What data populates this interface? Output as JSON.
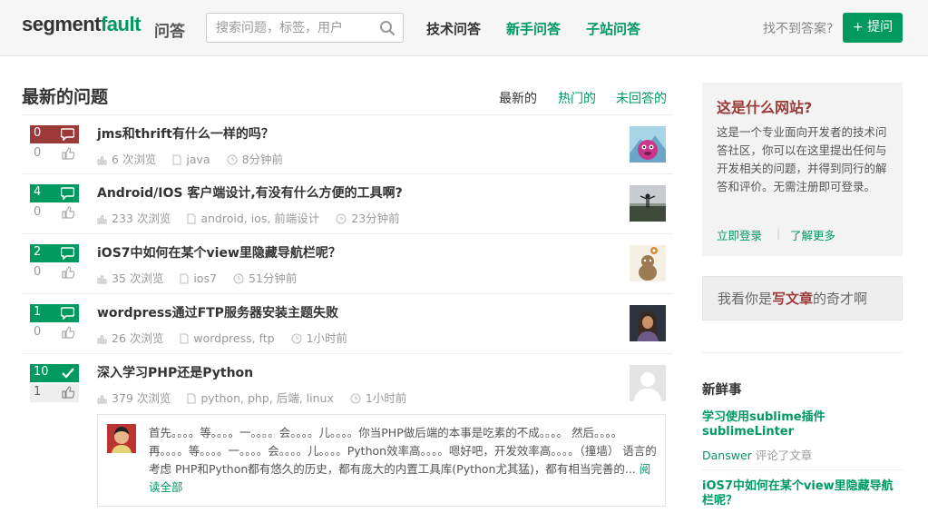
{
  "header": {
    "logo_part1": "segment",
    "logo_part2": "fault",
    "logo_sub": "问答",
    "search_placeholder": "搜索问题，标签，用户",
    "nav": [
      "技术问答",
      "新手问答",
      "子站问答"
    ],
    "no_answer": "找不到答案?",
    "ask_button": "+ 提问"
  },
  "main": {
    "title": "最新的问题",
    "tabs": [
      "最新的",
      "热门的",
      "未回答的"
    ],
    "questions": [
      {
        "answers": "0",
        "votes": "0",
        "title": "jms和thrift有什么一样的吗？",
        "views": "6 次浏览",
        "tags": "java",
        "time": "8分钟前"
      },
      {
        "answers": "4",
        "votes": "0",
        "title": "Android/IOS 客户端设计,有没有什么方便的工具啊?",
        "views": "233 次浏览",
        "tags": "android, ios, 前端设计",
        "time": "23分钟前"
      },
      {
        "answers": "2",
        "votes": "0",
        "title": "iOS7中如何在某个view里隐藏导航栏呢？",
        "views": "35 次浏览",
        "tags": "ios7",
        "time": "51分钟前"
      },
      {
        "answers": "1",
        "votes": "0",
        "title": "wordpress通过FTP服务器安装主题失败",
        "views": "26 次浏览",
        "tags": "wordpress, ftp",
        "time": "1小时前"
      },
      {
        "answers": "10",
        "votes": "1",
        "title": "深入学习PHP还是Python",
        "views": "379 次浏览",
        "tags": "python, php, 后端, linux",
        "time": "1小时前"
      }
    ],
    "preview_text": "首先。。。。等。。。。一。。。。会。。。。儿。。。。你当PHP做后端的本事是吃素的不成。。。。 然后。。。。再。。。。等。。。。一。。。。会。。。。儿。。。。Python效率高。。。。嗯好吧，开发效率高。。。。（撞墙） 语言的考虑 PHP和Python都有悠久的历史，都有庞大的内置工具库(Python尤其猛)，都有相当完善的...",
    "preview_more": "阅读全部"
  },
  "sidebar": {
    "about_title": "这是什么网站?",
    "about_desc": "这是一个专业面向开发者的技术问答社区，你可以在这里提出任何与开发相关的问题，并得到同行的解答和评价。无需注册即可登录。",
    "login_link": "立即登录",
    "sep": "|",
    "learn_link": "了解更多",
    "writer_pre": "我看你是",
    "writer_hl": "写文章",
    "writer_post": "的奇才啊",
    "news_title": "新鲜事",
    "news1_title": "学习使用sublime插件sublimeLinter",
    "news1_user": "Danswer",
    "news1_action": " 评论了文章",
    "news2_title": "iOS7中如何在某个view里隐藏导航栏呢？"
  },
  "colors": {
    "accent": "#009a61",
    "red": "#9c3a3a"
  }
}
